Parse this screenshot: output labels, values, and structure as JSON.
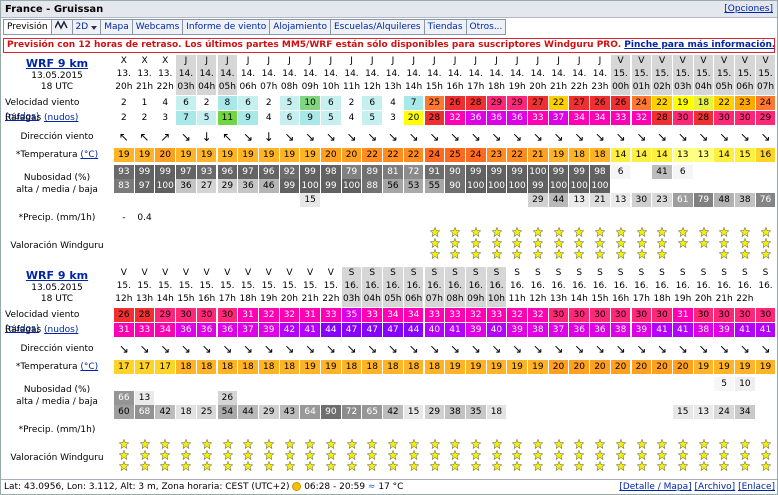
{
  "title": "France - Gruissan",
  "options_link": "[Opciones]",
  "tabs": [
    {
      "label": "Previsión",
      "selected": true
    },
    {
      "label": "",
      "icon": "wave-chart-icon"
    },
    {
      "label": "2D",
      "dropdown": true
    },
    {
      "label": "Mapa"
    },
    {
      "label": "Webcams"
    },
    {
      "label": "Informe de viento"
    },
    {
      "label": "Alojamiento"
    },
    {
      "label": "Escuelas/Alquileres"
    },
    {
      "label": "Tiendas"
    },
    {
      "label": "Otros..."
    }
  ],
  "notice": {
    "text": "Previsión con 12 horas de retraso. Los últimos partes MM5/WRF están sólo disponibles para suscriptores Windguru PRO.",
    "link": "Pinche para más información."
  },
  "labels": {
    "wind": "Velocidad viento",
    "gust": "Ráfagas",
    "knots": "(nudos)",
    "dir": "Dirección viento",
    "temp": "*Temperatura",
    "celsius": "(°C)",
    "cloud1": "Nubosidad (%)",
    "cloud2": "alta / media / baja",
    "precip": "*Precip. (mm/1h)",
    "rating": "Valoración Windguru"
  },
  "blocks": [
    {
      "model": "WRF 9 km",
      "date": "13.05.2015",
      "utc": "18 UTC",
      "days": [
        "X",
        "X",
        "X",
        "J",
        "J",
        "J",
        "J",
        "J",
        "J",
        "J",
        "J",
        "J",
        "J",
        "J",
        "J",
        "J",
        "J",
        "J",
        "J",
        "J",
        "J",
        "J",
        "J",
        "J",
        "V",
        "V",
        "V",
        "V",
        "V",
        "V",
        "V",
        "V"
      ],
      "dates": [
        "13.",
        "13.",
        "13.",
        "14.",
        "14.",
        "14.",
        "14.",
        "14.",
        "14.",
        "14.",
        "14.",
        "14.",
        "14.",
        "14.",
        "14.",
        "14.",
        "14.",
        "14.",
        "14.",
        "14.",
        "14.",
        "14.",
        "14.",
        "14.",
        "15.",
        "15.",
        "15.",
        "15.",
        "15.",
        "15.",
        "15.",
        "15."
      ],
      "hours": [
        "20h",
        "21h",
        "22h",
        "03h",
        "04h",
        "05h",
        "06h",
        "07h",
        "08h",
        "09h",
        "10h",
        "11h",
        "12h",
        "13h",
        "14h",
        "15h",
        "16h",
        "17h",
        "18h",
        "19h",
        "20h",
        "21h",
        "22h",
        "23h",
        "00h",
        "01h",
        "02h",
        "03h",
        "04h",
        "05h",
        "06h",
        "07h"
      ],
      "wind": [
        "2",
        "1",
        "4",
        "6",
        "2",
        "8",
        "6",
        "2",
        "5",
        "10",
        "6",
        "2",
        "6",
        "4",
        "7",
        "25",
        "26",
        "28",
        "29",
        "29",
        "27",
        "22",
        "27",
        "26",
        "26",
        "24",
        "22",
        "19",
        "18",
        "22",
        "23",
        "24"
      ],
      "gust": [
        "2",
        "2",
        "3",
        "7",
        "5",
        "11",
        "9",
        "4",
        "6",
        "9",
        "5",
        "4",
        "5",
        "3",
        "20",
        "28",
        "32",
        "36",
        "36",
        "36",
        "33",
        "37",
        "34",
        "34",
        "33",
        "32",
        "28",
        "30",
        "28",
        "30",
        "30",
        "29"
      ],
      "dir": [
        "↖",
        "↖",
        "↗",
        "↘",
        "↓",
        "↖",
        "↘",
        "↓",
        "↘",
        "↘",
        "↘",
        "↘",
        "↘",
        "↘",
        "↘",
        "↘",
        "↘",
        "↘",
        "↘",
        "↘",
        "↘",
        "↘",
        "↘",
        "↘",
        "↘",
        "↘",
        "↘",
        "↘",
        "↘",
        "↘",
        "↘",
        "↘"
      ],
      "temp": [
        "19",
        "19",
        "20",
        "19",
        "19",
        "19",
        "19",
        "19",
        "19",
        "19",
        "20",
        "20",
        "22",
        "22",
        "22",
        "24",
        "25",
        "24",
        "23",
        "22",
        "21",
        "19",
        "18",
        "18",
        "14",
        "14",
        "14",
        "13",
        "13",
        "14",
        "15",
        "16"
      ],
      "cloud_high": [
        "93",
        "99",
        "99",
        "97",
        "93",
        "96",
        "97",
        "96",
        "92",
        "99",
        "98",
        "79",
        "89",
        "81",
        "72",
        "91",
        "90",
        "99",
        "99",
        "99",
        "100",
        "99",
        "99",
        "98",
        "6",
        "",
        "41",
        "6",
        "",
        "",
        "",
        ""
      ],
      "cloud_low": [
        "83",
        "97",
        "100",
        "36",
        "27",
        "29",
        "36",
        "46",
        "99",
        "100",
        "99",
        "100",
        "88",
        "56",
        "53",
        "55",
        "90",
        "100",
        "100",
        "100",
        "99",
        "100",
        "100",
        "100",
        "",
        "",
        "",
        "",
        "",
        "",
        "",
        ""
      ],
      "cloud_extra": [
        "",
        "",
        "",
        "",
        "",
        "",
        "",
        "",
        "",
        "15",
        "",
        "",
        "",
        "",
        "",
        "",
        "",
        "",
        "",
        "",
        "29",
        "44",
        "13",
        "21",
        "13",
        "30",
        "23",
        "61",
        "79",
        "48",
        "38",
        "76"
      ],
      "precip": [
        "-",
        "0.4"
      ],
      "stars": [
        0,
        0,
        0,
        0,
        0,
        0,
        0,
        0,
        0,
        0,
        0,
        0,
        0,
        0,
        0,
        3,
        3,
        3,
        3,
        3,
        3,
        3,
        3,
        3,
        3,
        3,
        3,
        2,
        2,
        3,
        3,
        3
      ]
    },
    {
      "model": "WRF 9 km",
      "date": "13.05.2015",
      "utc": "18 UTC",
      "days": [
        "V",
        "V",
        "V",
        "V",
        "V",
        "V",
        "V",
        "V",
        "V",
        "V",
        "V",
        "S",
        "S",
        "S",
        "S",
        "S",
        "S",
        "S",
        "S",
        "S",
        "S",
        "S",
        "S",
        "S",
        "S",
        "S",
        "S",
        "S",
        "S",
        "S",
        "S",
        "S"
      ],
      "dates": [
        "15.",
        "15.",
        "15.",
        "15.",
        "15.",
        "15.",
        "15.",
        "15.",
        "15.",
        "15.",
        "15.",
        "16.",
        "16.",
        "16.",
        "16.",
        "16.",
        "16.",
        "16.",
        "16.",
        "16.",
        "16.",
        "16.",
        "16.",
        "16.",
        "16.",
        "16.",
        "16.",
        "16.",
        "16.",
        "16.",
        "16.",
        "16."
      ],
      "hours": [
        "12h",
        "13h",
        "14h",
        "15h",
        "16h",
        "17h",
        "18h",
        "19h",
        "20h",
        "21h",
        "22h",
        "03h",
        "04h",
        "05h",
        "06h",
        "07h",
        "08h",
        "09h",
        "10h",
        "11h",
        "12h",
        "13h",
        "14h",
        "15h",
        "16h",
        "17h",
        "18h",
        "19h",
        "20h",
        "21h",
        "22h",
        ""
      ],
      "wind": [
        "26",
        "28",
        "29",
        "30",
        "30",
        "30",
        "31",
        "32",
        "32",
        "31",
        "33",
        "35",
        "33",
        "34",
        "34",
        "33",
        "33",
        "32",
        "33",
        "32",
        "32",
        "30",
        "30",
        "30",
        "30",
        "30",
        "30",
        "31",
        "30",
        "30",
        "30",
        "30"
      ],
      "gust": [
        "31",
        "33",
        "34",
        "36",
        "36",
        "36",
        "37",
        "39",
        "42",
        "41",
        "44",
        "47",
        "47",
        "47",
        "44",
        "40",
        "41",
        "39",
        "40",
        "39",
        "38",
        "37",
        "36",
        "36",
        "38",
        "39",
        "41",
        "41",
        "38",
        "39",
        "41",
        "41"
      ],
      "dir": [
        "↘",
        "↘",
        "↘",
        "↘",
        "↘",
        "↘",
        "↘",
        "↘",
        "↘",
        "↘",
        "↘",
        "↘",
        "↘",
        "↘",
        "↘",
        "↘",
        "↘",
        "↘",
        "↘",
        "↘",
        "↘",
        "↘",
        "↘",
        "↘",
        "↘",
        "↘",
        "↘",
        "↘",
        "↘",
        "↘",
        "↘",
        "↘"
      ],
      "temp": [
        "17",
        "17",
        "17",
        "18",
        "18",
        "18",
        "18",
        "18",
        "18",
        "19",
        "19",
        "18",
        "18",
        "18",
        "18",
        "18",
        "19",
        "19",
        "19",
        "19",
        "19",
        "20",
        "20",
        "20",
        "20",
        "20",
        "20",
        "20",
        "19",
        "19",
        "19",
        "19"
      ],
      "cloud_high": [
        "",
        "",
        "",
        "",
        "",
        "",
        "",
        "",
        "",
        "",
        "",
        "",
        "",
        "",
        "",
        "",
        "",
        "",
        "",
        "",
        "",
        "",
        "",
        "",
        "",
        "",
        "",
        "",
        "",
        "5",
        "10",
        ""
      ],
      "cloud_mid": [
        "66",
        "13",
        "",
        "",
        "",
        "26",
        "",
        "",
        "",
        "",
        "",
        "",
        "",
        "",
        "",
        "",
        "",
        "",
        "",
        "",
        "",
        "",
        "",
        "",
        "",
        "",
        "",
        "",
        "",
        "",
        "",
        ""
      ],
      "cloud_low": [
        "60",
        "68",
        "42",
        "18",
        "25",
        "54",
        "44",
        "29",
        "43",
        "64",
        "90",
        "72",
        "65",
        "42",
        "15",
        "29",
        "38",
        "35",
        "18",
        "",
        "",
        "",
        "",
        "",
        "",
        "",
        "",
        "15",
        "13",
        "24",
        "34",
        ""
      ],
      "precip": [],
      "stars": [
        3,
        3,
        3,
        3,
        3,
        3,
        3,
        3,
        3,
        3,
        3,
        3,
        3,
        3,
        3,
        3,
        3,
        3,
        3,
        3,
        3,
        3,
        3,
        3,
        3,
        3,
        3,
        3,
        3,
        3,
        3,
        3
      ]
    }
  ],
  "footer": {
    "text": "Lat: 43.0956, Lon: 3.112, Alt: 3 m, Zona horaria: CEST (UTC+2)",
    "sun": "06:28 - 20:59",
    "water": "17 °C",
    "links": [
      "[Detalle / Mapa]",
      "[Archivo]",
      "[Enlace]"
    ]
  },
  "colors": {
    "calm": "#ffffff",
    "light_blue": "#c6f0f0",
    "cyan": "#a8e8e8",
    "green": "#7fd67f",
    "lime": "#b8e860",
    "yellow": "#ffff00",
    "orange": "#ffa800",
    "red": "#f03030",
    "magenta": "#ff00b4",
    "purple": "#b400ff",
    "violet": "#8800ff"
  }
}
